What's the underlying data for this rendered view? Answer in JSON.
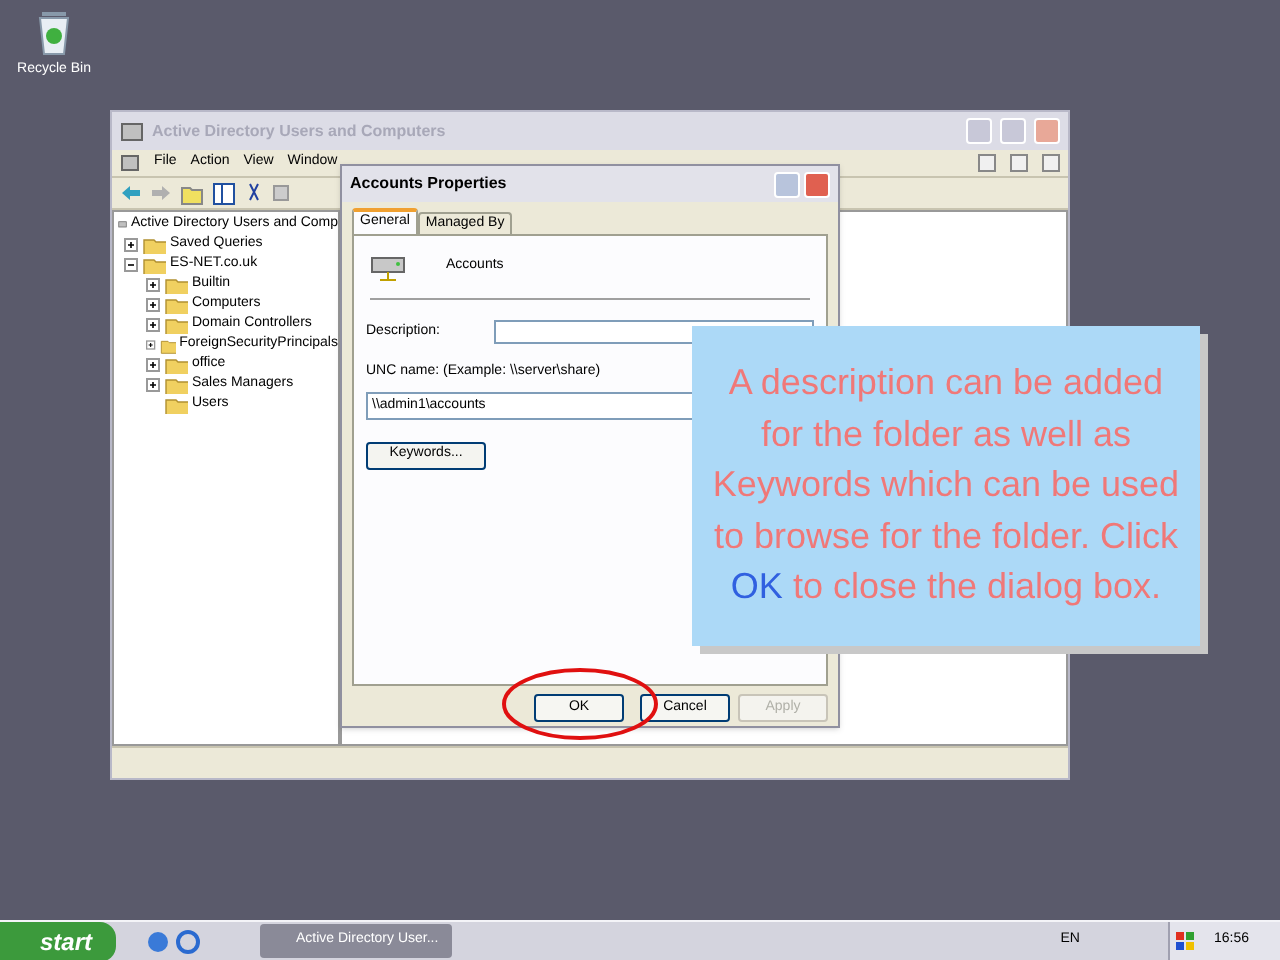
{
  "desktop": {
    "icons": [
      {
        "label": "Recycle Bin"
      }
    ]
  },
  "main_window": {
    "title": "Active Directory Users and Computers",
    "active": false,
    "menu": [
      "File",
      "Action",
      "View",
      "Window"
    ],
    "tree": [
      {
        "label": "Active Directory Users and Comp",
        "children": [
          {
            "label": "Saved Queries",
            "expanded": false
          },
          {
            "label": "ES-NET.co.uk",
            "expanded": true,
            "children": [
              {
                "label": "Builtin",
                "expanded": false
              },
              {
                "label": "Computers",
                "expanded": false
              },
              {
                "label": "Domain Controllers",
                "expanded": false
              },
              {
                "label": "ForeignSecurityPrincipals",
                "expanded": false
              },
              {
                "label": "office",
                "expanded": false
              },
              {
                "label": "Sales Managers",
                "expanded": false
              },
              {
                "label": "Users"
              }
            ]
          }
        ]
      }
    ]
  },
  "dialog": {
    "title": "Accounts Properties",
    "tabs": [
      {
        "label": "General",
        "selected": true
      },
      {
        "label": "Managed By",
        "selected": false
      }
    ],
    "object_name": "Accounts",
    "description": {
      "label": "Description:"
    },
    "unc": {
      "label": "UNC name: (Example: \\\\server\\share)",
      "value": "\\\\admin1\\accounts"
    },
    "keywords_button": "Keywords...",
    "buttons": [
      {
        "label": "OK",
        "disabled": false
      },
      {
        "label": "Cancel",
        "disabled": false
      },
      {
        "label": "Apply",
        "disabled": true
      }
    ]
  },
  "callout": {
    "segments": [
      {
        "text": "A description can be added for the folder as well as Keywords which can be used to browse for the folder. Click ",
        "kind": "plain"
      },
      {
        "text": "OK",
        "kind": "highlight"
      },
      {
        "text": " to close the dialog box.",
        "kind": "plain"
      }
    ]
  },
  "taskbar": {
    "start": "start",
    "tasks": [
      {
        "label": "Active Directory User...",
        "selected": false
      }
    ],
    "language": "EN",
    "clock": "16:56"
  }
}
